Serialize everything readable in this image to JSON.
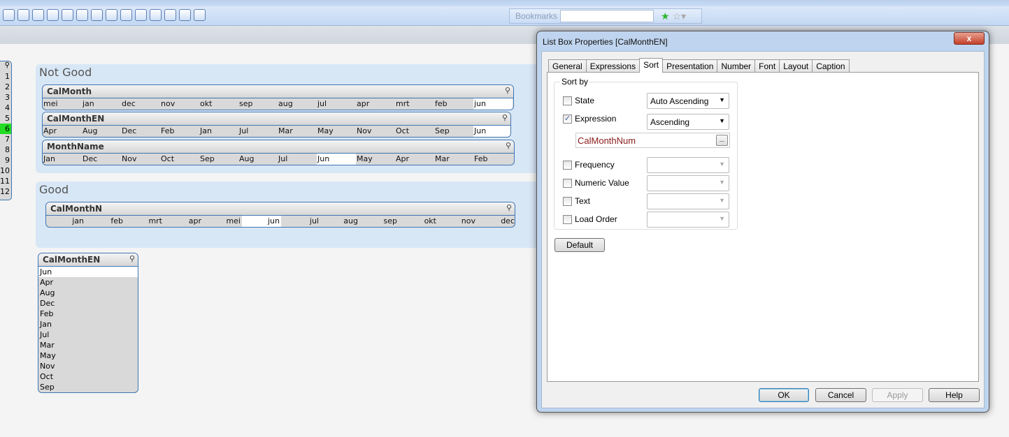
{
  "toolbar": {
    "bookmarks_label": "Bookmarks",
    "bookmarks_value": ""
  },
  "left_listbox": {
    "items": [
      "1",
      "2",
      "3",
      "4",
      "5",
      "6",
      "7",
      "8",
      "9",
      "10",
      "11",
      "12"
    ],
    "selected": "6",
    "selected_color": "#22dd22"
  },
  "not_good": {
    "title": "Not Good",
    "boxes": [
      {
        "caption": "CalMonth",
        "items": [
          "mei",
          "jan",
          "dec",
          "nov",
          "okt",
          "sep",
          "aug",
          "jul",
          "apr",
          "mrt",
          "feb",
          "jun"
        ],
        "selected": "jun"
      },
      {
        "caption": "CalMonthEN",
        "items": [
          "Apr",
          "Aug",
          "Dec",
          "Feb",
          "Jan",
          "Jul",
          "Mar",
          "May",
          "Nov",
          "Oct",
          "Sep",
          "Jun"
        ],
        "selected": "Jun"
      },
      {
        "caption": "MonthName",
        "items": [
          "Jan",
          "Dec",
          "Nov",
          "Oct",
          "Sep",
          "Aug",
          "Jul",
          "Jun",
          "May",
          "Apr",
          "Mar",
          "Feb"
        ],
        "selected": "Jun"
      }
    ]
  },
  "good": {
    "title": "Good",
    "boxes": [
      {
        "caption": "CalMonthN",
        "items": [
          "jan",
          "feb",
          "mrt",
          "apr",
          "mei",
          "jun",
          "jul",
          "aug",
          "sep",
          "okt",
          "nov",
          "dec"
        ],
        "selected": "jun"
      }
    ]
  },
  "vertical_listbox": {
    "caption": "CalMonthEN",
    "items": [
      "Jun",
      "Apr",
      "Aug",
      "Dec",
      "Feb",
      "Jan",
      "Jul",
      "Mar",
      "May",
      "Nov",
      "Oct",
      "Sep"
    ],
    "selected": "Jun"
  },
  "dialog": {
    "title": "List Box Properties [CalMonthEN]",
    "close": "x",
    "tabs": [
      "General",
      "Expressions",
      "Sort",
      "Presentation",
      "Number",
      "Font",
      "Layout",
      "Caption"
    ],
    "active_tab": "Sort",
    "sort_group": "Sort by",
    "options": [
      {
        "label": "State",
        "checked": false,
        "value": "Auto Ascending",
        "enabled": true
      },
      {
        "label": "Expression",
        "checked": true,
        "value": "Ascending",
        "enabled": true
      },
      {
        "label": "Frequency",
        "checked": false,
        "value": "",
        "enabled": false
      },
      {
        "label": "Numeric Value",
        "checked": false,
        "value": "",
        "enabled": false
      },
      {
        "label": "Text",
        "checked": false,
        "value": "",
        "enabled": false
      },
      {
        "label": "Load Order",
        "checked": false,
        "value": "",
        "enabled": false
      }
    ],
    "expression": "CalMonthNum",
    "expression_button": "...",
    "default_button": "Default",
    "buttons": {
      "ok": "OK",
      "cancel": "Cancel",
      "apply": "Apply",
      "help": "Help"
    }
  }
}
